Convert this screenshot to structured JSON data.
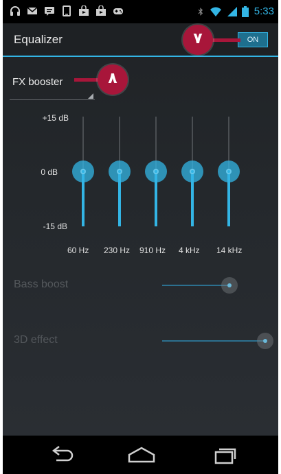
{
  "status_bar": {
    "time": "5:33",
    "left_icons": [
      "headset-icon",
      "gmail-icon",
      "message-icon",
      "phone-icon",
      "shop-icon",
      "shop-icon",
      "game-controller-icon"
    ],
    "right_icons": [
      "bluetooth-icon",
      "wifi-icon",
      "cell-signal-icon",
      "battery-icon"
    ]
  },
  "action_bar": {
    "title": "Equalizer",
    "toggle_label": "ON"
  },
  "callouts": {
    "toggle_callout": "٧",
    "spinner_callout": "٨"
  },
  "spinner": {
    "selected": "FX booster"
  },
  "equalizer": {
    "db_labels": {
      "top": "+15 dB",
      "middle": "0 dB",
      "bottom": "-15 dB"
    },
    "bands": [
      {
        "label": "60 Hz",
        "level_db": 0
      },
      {
        "label": "230 Hz",
        "level_db": 0
      },
      {
        "label": "910 Hz",
        "level_db": 0
      },
      {
        "label": "4 kHz",
        "level_db": 0
      },
      {
        "label": "14 kHz",
        "level_db": 0
      }
    ]
  },
  "effects": {
    "bass_boost": {
      "label": "Bass boost",
      "level": 0.65
    },
    "effect_3d": {
      "label": "3D effect",
      "level": 1.0
    }
  },
  "colors": {
    "accent": "#33b5e5",
    "callout": "#a8163a"
  },
  "nav": {
    "icons": [
      "back-icon",
      "home-icon",
      "recent-apps-icon"
    ]
  }
}
